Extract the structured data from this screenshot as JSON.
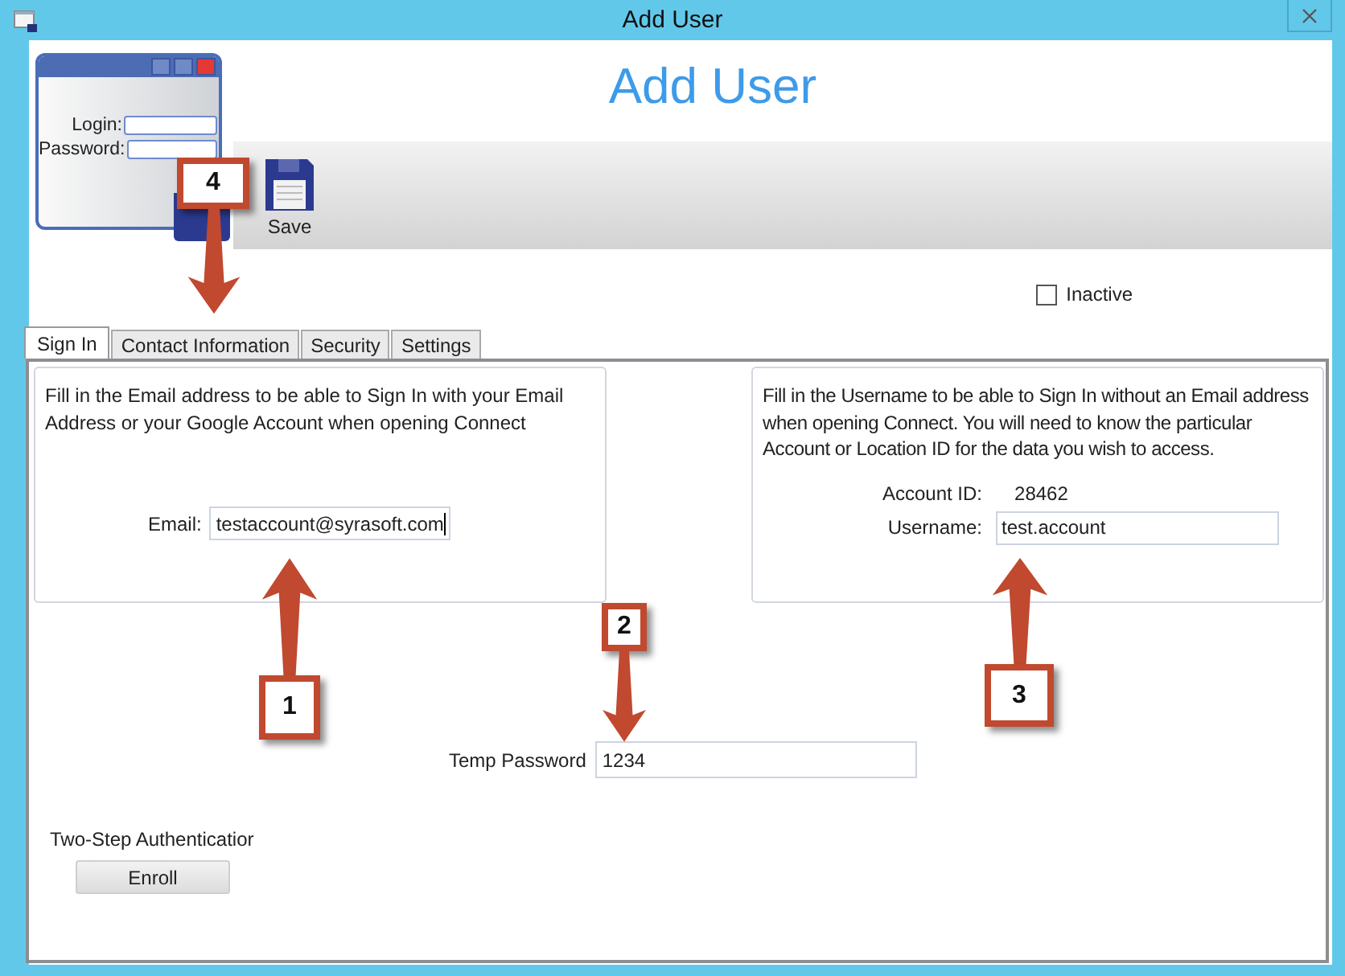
{
  "window": {
    "title": "Add User"
  },
  "header": {
    "title": "Add User"
  },
  "toolbar": {
    "buttons": [
      {
        "label": "Save"
      }
    ]
  },
  "login_illustration": {
    "fields": [
      {
        "label": "Login:"
      },
      {
        "label": "Password:"
      }
    ]
  },
  "inactive": {
    "label": "Inactive",
    "checked": false
  },
  "tabs": [
    {
      "label": "Sign In",
      "selected": true
    },
    {
      "label": "Contact Information",
      "selected": false
    },
    {
      "label": "Security",
      "selected": false
    },
    {
      "label": "Settings",
      "selected": false
    }
  ],
  "email_group": {
    "description": "Fill in the Email address to be able to Sign In with your Email Address or your Google Account when opening Connect",
    "email_label": "Email:",
    "email_value": "testaccount@syrasoft.com"
  },
  "username_group": {
    "description": "Fill in the Username to be able to Sign In without an Email address when opening Connect. You will need to know the particular Account or Location ID for the data you wish to access.",
    "account_id_label": "Account ID:",
    "account_id_value": "28462",
    "username_label": "Username:",
    "username_value": "test.account"
  },
  "temp_password": {
    "label": "Temp Password",
    "value": "1234"
  },
  "two_step": {
    "label": "Two-Step Authenticatior",
    "button": "Enroll"
  },
  "callouts": [
    {
      "number": "1",
      "kind": "up"
    },
    {
      "number": "2",
      "kind": "down"
    },
    {
      "number": "3",
      "kind": "up"
    },
    {
      "number": "4",
      "kind": "down"
    }
  ]
}
